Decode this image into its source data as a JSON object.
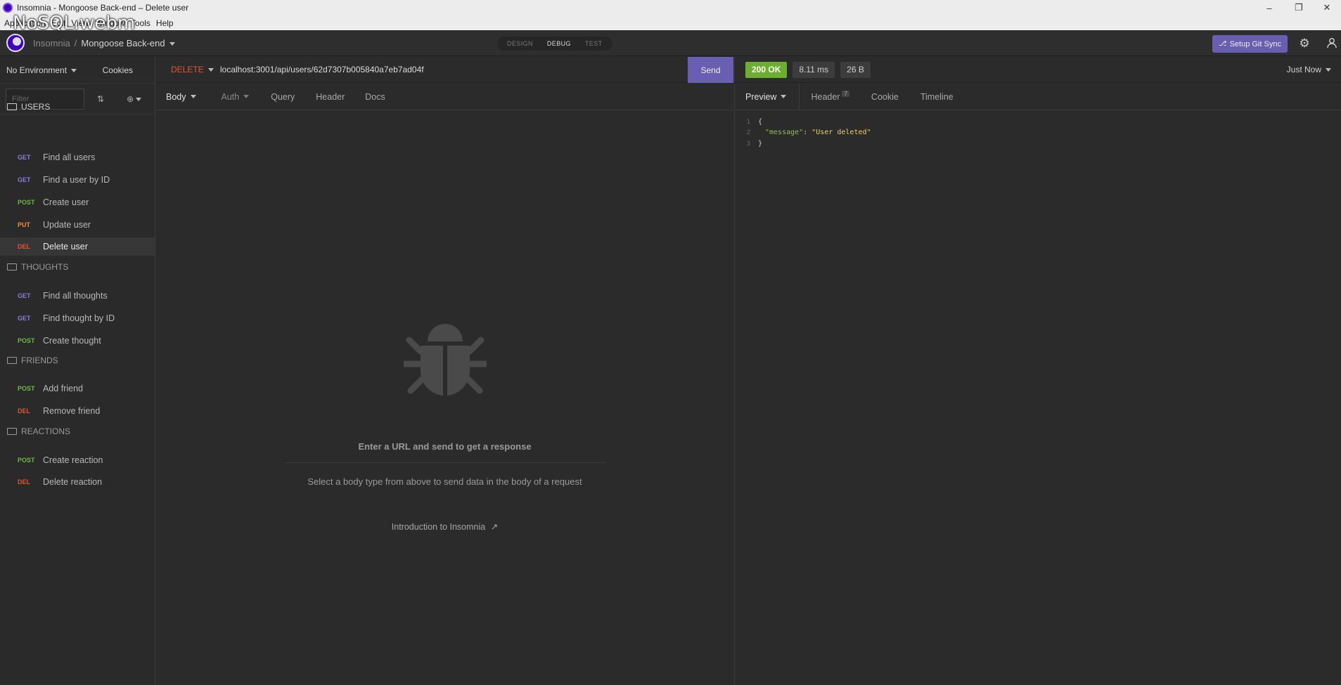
{
  "window": {
    "title": "Insomnia - Mongoose Back-end – Delete user",
    "overlay_caption": "NoSQL.webm",
    "menu": [
      "Application",
      "Edit",
      "View",
      "Window",
      "Tools",
      "Help"
    ],
    "controls": {
      "minimize": "–",
      "maximize": "❐",
      "close": "✕"
    }
  },
  "header": {
    "app_name": "Insomnia",
    "separator": "/",
    "project": "Mongoose Back-end",
    "mode_tabs": [
      "DESIGN",
      "DEBUG",
      "TEST"
    ],
    "active_mode": "DEBUG",
    "git_sync_label": "Setup Git Sync",
    "accent_color": "#6a5eb3"
  },
  "sidebar": {
    "environment": "No Environment",
    "cookies_label": "Cookies",
    "filter_placeholder": "Filter",
    "folders": [
      {
        "name": "USERS",
        "open": true,
        "requests": [
          {
            "verb": "GET",
            "label": "Find all users"
          },
          {
            "verb": "GET",
            "label": "Find a user by ID"
          },
          {
            "verb": "POST",
            "label": "Create user"
          },
          {
            "verb": "PUT",
            "label": "Update user"
          },
          {
            "verb": "DEL",
            "label": "Delete user",
            "active": true
          }
        ]
      },
      {
        "name": "THOUGHTS",
        "open": false,
        "requests": [
          {
            "verb": "GET",
            "label": "Find all thoughts"
          },
          {
            "verb": "GET",
            "label": "Find thought by ID"
          },
          {
            "verb": "POST",
            "label": "Create thought"
          }
        ]
      },
      {
        "name": "FRIENDS",
        "open": false,
        "requests": [
          {
            "verb": "POST",
            "label": "Add friend"
          },
          {
            "verb": "DEL",
            "label": "Remove friend"
          }
        ]
      },
      {
        "name": "REACTIONS",
        "open": false,
        "requests": [
          {
            "verb": "POST",
            "label": "Create reaction"
          },
          {
            "verb": "DEL",
            "label": "Delete reaction"
          }
        ]
      }
    ]
  },
  "request": {
    "method": "DELETE",
    "url": "localhost:3001/api/users/62d7307b005840a7eb7ad04f",
    "send_label": "Send",
    "tabs": [
      "Body",
      "Auth",
      "Query",
      "Header",
      "Docs"
    ],
    "empty_title": "Enter a URL and send to get a response",
    "empty_sub": "Select a body type from above to send data in the body of a request",
    "intro_link": "Introduction to Insomnia"
  },
  "response": {
    "status": "200 OK",
    "time": "8.11 ms",
    "size": "26 B",
    "when": "Just Now",
    "tabs": [
      "Preview",
      "Header",
      "Cookie",
      "Timeline"
    ],
    "header_count": "7",
    "body_lines": [
      {
        "n": "1",
        "text": "{"
      },
      {
        "n": "2",
        "key": "\"message\"",
        "value": "\"User deleted\""
      },
      {
        "n": "3",
        "text": "}"
      }
    ],
    "status_color": "#6cae2f"
  }
}
